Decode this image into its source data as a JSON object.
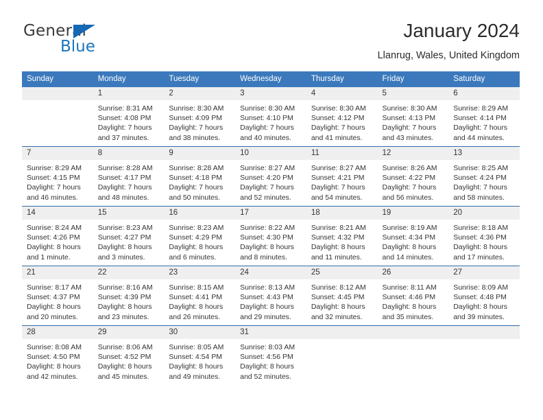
{
  "brand": {
    "name_part1": "General",
    "name_part2": "Blue",
    "logo_icon": "triangle-logo-icon"
  },
  "header": {
    "month_title": "January 2024",
    "location": "Llanrug, Wales, United Kingdom"
  },
  "colors": {
    "header_blue": "#3b79bc",
    "row_divider_blue": "#2f6da8",
    "day_number_band": "#efefef",
    "brand_blue": "#1b75bc",
    "text": "#333333"
  },
  "weekday_headers": [
    "Sunday",
    "Monday",
    "Tuesday",
    "Wednesday",
    "Thursday",
    "Friday",
    "Saturday"
  ],
  "weeks": [
    [
      {
        "day": "",
        "sunrise": "",
        "sunset": "",
        "daylight_line1": "",
        "daylight_line2": ""
      },
      {
        "day": "1",
        "sunrise": "Sunrise: 8:31 AM",
        "sunset": "Sunset: 4:08 PM",
        "daylight_line1": "Daylight: 7 hours",
        "daylight_line2": "and 37 minutes."
      },
      {
        "day": "2",
        "sunrise": "Sunrise: 8:30 AM",
        "sunset": "Sunset: 4:09 PM",
        "daylight_line1": "Daylight: 7 hours",
        "daylight_line2": "and 38 minutes."
      },
      {
        "day": "3",
        "sunrise": "Sunrise: 8:30 AM",
        "sunset": "Sunset: 4:10 PM",
        "daylight_line1": "Daylight: 7 hours",
        "daylight_line2": "and 40 minutes."
      },
      {
        "day": "4",
        "sunrise": "Sunrise: 8:30 AM",
        "sunset": "Sunset: 4:12 PM",
        "daylight_line1": "Daylight: 7 hours",
        "daylight_line2": "and 41 minutes."
      },
      {
        "day": "5",
        "sunrise": "Sunrise: 8:30 AM",
        "sunset": "Sunset: 4:13 PM",
        "daylight_line1": "Daylight: 7 hours",
        "daylight_line2": "and 43 minutes."
      },
      {
        "day": "6",
        "sunrise": "Sunrise: 8:29 AM",
        "sunset": "Sunset: 4:14 PM",
        "daylight_line1": "Daylight: 7 hours",
        "daylight_line2": "and 44 minutes."
      }
    ],
    [
      {
        "day": "7",
        "sunrise": "Sunrise: 8:29 AM",
        "sunset": "Sunset: 4:15 PM",
        "daylight_line1": "Daylight: 7 hours",
        "daylight_line2": "and 46 minutes."
      },
      {
        "day": "8",
        "sunrise": "Sunrise: 8:28 AM",
        "sunset": "Sunset: 4:17 PM",
        "daylight_line1": "Daylight: 7 hours",
        "daylight_line2": "and 48 minutes."
      },
      {
        "day": "9",
        "sunrise": "Sunrise: 8:28 AM",
        "sunset": "Sunset: 4:18 PM",
        "daylight_line1": "Daylight: 7 hours",
        "daylight_line2": "and 50 minutes."
      },
      {
        "day": "10",
        "sunrise": "Sunrise: 8:27 AM",
        "sunset": "Sunset: 4:20 PM",
        "daylight_line1": "Daylight: 7 hours",
        "daylight_line2": "and 52 minutes."
      },
      {
        "day": "11",
        "sunrise": "Sunrise: 8:27 AM",
        "sunset": "Sunset: 4:21 PM",
        "daylight_line1": "Daylight: 7 hours",
        "daylight_line2": "and 54 minutes."
      },
      {
        "day": "12",
        "sunrise": "Sunrise: 8:26 AM",
        "sunset": "Sunset: 4:22 PM",
        "daylight_line1": "Daylight: 7 hours",
        "daylight_line2": "and 56 minutes."
      },
      {
        "day": "13",
        "sunrise": "Sunrise: 8:25 AM",
        "sunset": "Sunset: 4:24 PM",
        "daylight_line1": "Daylight: 7 hours",
        "daylight_line2": "and 58 minutes."
      }
    ],
    [
      {
        "day": "14",
        "sunrise": "Sunrise: 8:24 AM",
        "sunset": "Sunset: 4:26 PM",
        "daylight_line1": "Daylight: 8 hours",
        "daylight_line2": "and 1 minute."
      },
      {
        "day": "15",
        "sunrise": "Sunrise: 8:23 AM",
        "sunset": "Sunset: 4:27 PM",
        "daylight_line1": "Daylight: 8 hours",
        "daylight_line2": "and 3 minutes."
      },
      {
        "day": "16",
        "sunrise": "Sunrise: 8:23 AM",
        "sunset": "Sunset: 4:29 PM",
        "daylight_line1": "Daylight: 8 hours",
        "daylight_line2": "and 6 minutes."
      },
      {
        "day": "17",
        "sunrise": "Sunrise: 8:22 AM",
        "sunset": "Sunset: 4:30 PM",
        "daylight_line1": "Daylight: 8 hours",
        "daylight_line2": "and 8 minutes."
      },
      {
        "day": "18",
        "sunrise": "Sunrise: 8:21 AM",
        "sunset": "Sunset: 4:32 PM",
        "daylight_line1": "Daylight: 8 hours",
        "daylight_line2": "and 11 minutes."
      },
      {
        "day": "19",
        "sunrise": "Sunrise: 8:19 AM",
        "sunset": "Sunset: 4:34 PM",
        "daylight_line1": "Daylight: 8 hours",
        "daylight_line2": "and 14 minutes."
      },
      {
        "day": "20",
        "sunrise": "Sunrise: 8:18 AM",
        "sunset": "Sunset: 4:36 PM",
        "daylight_line1": "Daylight: 8 hours",
        "daylight_line2": "and 17 minutes."
      }
    ],
    [
      {
        "day": "21",
        "sunrise": "Sunrise: 8:17 AM",
        "sunset": "Sunset: 4:37 PM",
        "daylight_line1": "Daylight: 8 hours",
        "daylight_line2": "and 20 minutes."
      },
      {
        "day": "22",
        "sunrise": "Sunrise: 8:16 AM",
        "sunset": "Sunset: 4:39 PM",
        "daylight_line1": "Daylight: 8 hours",
        "daylight_line2": "and 23 minutes."
      },
      {
        "day": "23",
        "sunrise": "Sunrise: 8:15 AM",
        "sunset": "Sunset: 4:41 PM",
        "daylight_line1": "Daylight: 8 hours",
        "daylight_line2": "and 26 minutes."
      },
      {
        "day": "24",
        "sunrise": "Sunrise: 8:13 AM",
        "sunset": "Sunset: 4:43 PM",
        "daylight_line1": "Daylight: 8 hours",
        "daylight_line2": "and 29 minutes."
      },
      {
        "day": "25",
        "sunrise": "Sunrise: 8:12 AM",
        "sunset": "Sunset: 4:45 PM",
        "daylight_line1": "Daylight: 8 hours",
        "daylight_line2": "and 32 minutes."
      },
      {
        "day": "26",
        "sunrise": "Sunrise: 8:11 AM",
        "sunset": "Sunset: 4:46 PM",
        "daylight_line1": "Daylight: 8 hours",
        "daylight_line2": "and 35 minutes."
      },
      {
        "day": "27",
        "sunrise": "Sunrise: 8:09 AM",
        "sunset": "Sunset: 4:48 PM",
        "daylight_line1": "Daylight: 8 hours",
        "daylight_line2": "and 39 minutes."
      }
    ],
    [
      {
        "day": "28",
        "sunrise": "Sunrise: 8:08 AM",
        "sunset": "Sunset: 4:50 PM",
        "daylight_line1": "Daylight: 8 hours",
        "daylight_line2": "and 42 minutes."
      },
      {
        "day": "29",
        "sunrise": "Sunrise: 8:06 AM",
        "sunset": "Sunset: 4:52 PM",
        "daylight_line1": "Daylight: 8 hours",
        "daylight_line2": "and 45 minutes."
      },
      {
        "day": "30",
        "sunrise": "Sunrise: 8:05 AM",
        "sunset": "Sunset: 4:54 PM",
        "daylight_line1": "Daylight: 8 hours",
        "daylight_line2": "and 49 minutes."
      },
      {
        "day": "31",
        "sunrise": "Sunrise: 8:03 AM",
        "sunset": "Sunset: 4:56 PM",
        "daylight_line1": "Daylight: 8 hours",
        "daylight_line2": "and 52 minutes."
      },
      {
        "day": "",
        "sunrise": "",
        "sunset": "",
        "daylight_line1": "",
        "daylight_line2": ""
      },
      {
        "day": "",
        "sunrise": "",
        "sunset": "",
        "daylight_line1": "",
        "daylight_line2": ""
      },
      {
        "day": "",
        "sunrise": "",
        "sunset": "",
        "daylight_line1": "",
        "daylight_line2": ""
      }
    ]
  ]
}
